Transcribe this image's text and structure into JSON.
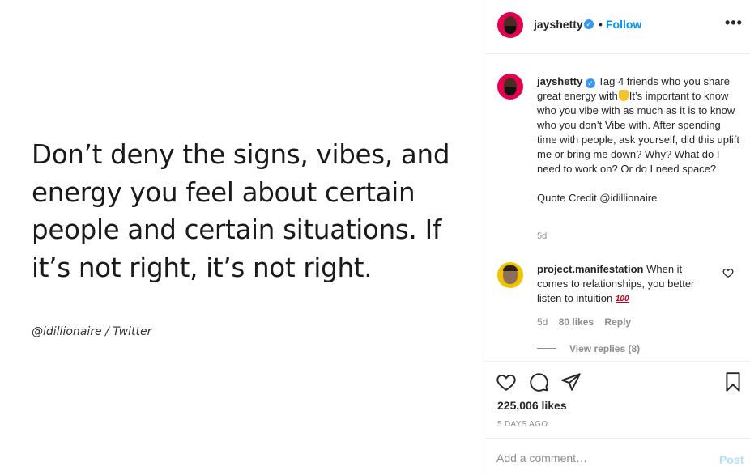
{
  "post_image": {
    "quote": "Don’t deny the signs, vibes, and energy you feel about certain people and certain situations. If it’s not right, it’s not right.",
    "credit": "@idillionaire / Twitter"
  },
  "header": {
    "username": "jayshetty",
    "dot": "•",
    "follow_label": "Follow",
    "more_label": "•••"
  },
  "caption": {
    "username": "jayshetty",
    "text_part1": "Tag 4 friends who you share great energy with",
    "text_part2": "It’s important to know who you vibe with as much as it is to know who you don’t Vibe with. After spending time with people, ask yourself, did this uplift me or bring me down? Why? What do I need to work on? Or do I need space?",
    "text_part3": "Quote Credit @idillionaire",
    "time": "5d"
  },
  "comment": {
    "username": "project.manifestation",
    "text": "When it comes to relationships, you better listen to intuition",
    "emoji": "100",
    "time": "5d",
    "likes": "80 likes",
    "reply_label": "Reply",
    "view_replies": "View replies (8)"
  },
  "actions": {
    "likes": "225,006 likes",
    "date": "5 DAYS AGO"
  },
  "add_comment": {
    "placeholder": "Add a comment…",
    "post_label": "Post"
  },
  "colors": {
    "accent": "#0095f6",
    "verified": "#3897f0",
    "muted": "#8e8e8e",
    "post_disabled": "#b2dffc"
  }
}
